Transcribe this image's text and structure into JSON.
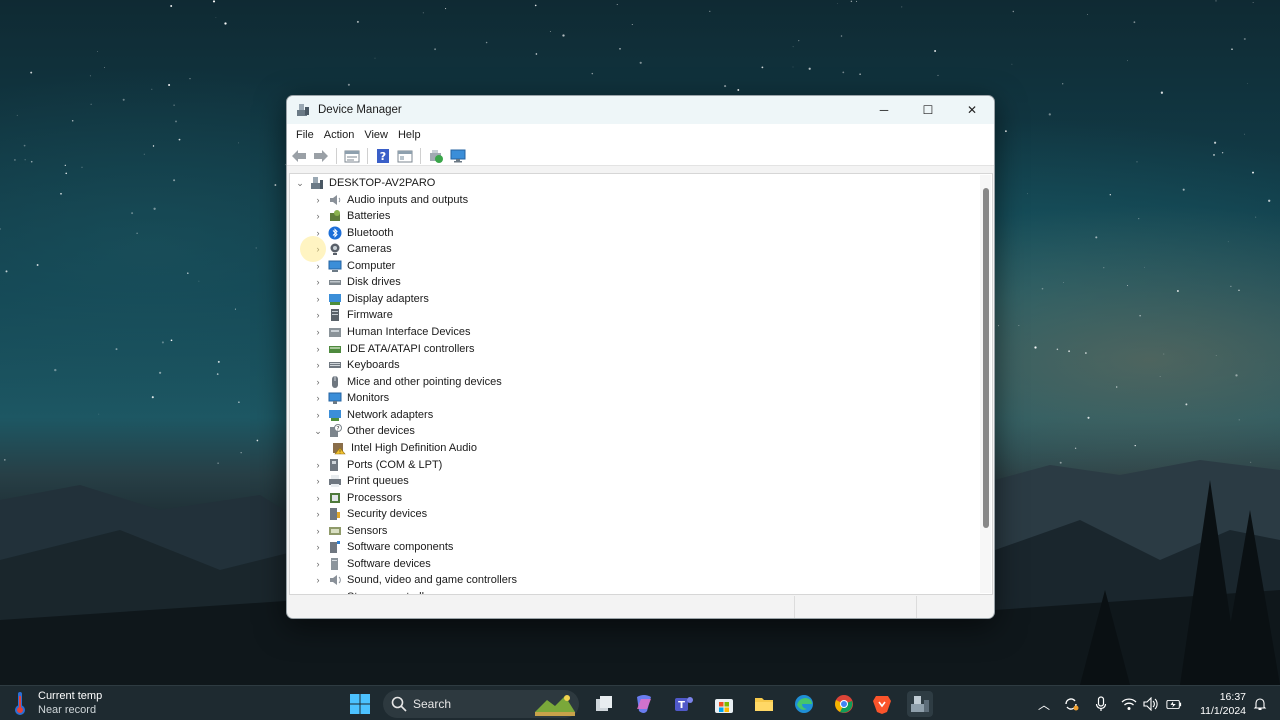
{
  "window": {
    "title": "Device Manager",
    "minimize_label": "─",
    "maximize_label": "☐",
    "close_label": "✕"
  },
  "menu": [
    "File",
    "Action",
    "View",
    "Help"
  ],
  "tree": {
    "root": "DESKTOP-AV2PARO",
    "items": [
      {
        "label": "Audio inputs and outputs",
        "icon": "speaker-icon",
        "expanded": false
      },
      {
        "label": "Batteries",
        "icon": "battery-icon",
        "expanded": false
      },
      {
        "label": "Bluetooth",
        "icon": "bluetooth-icon",
        "expanded": false
      },
      {
        "label": "Cameras",
        "icon": "camera-icon",
        "expanded": false
      },
      {
        "label": "Computer",
        "icon": "computer-icon",
        "expanded": false
      },
      {
        "label": "Disk drives",
        "icon": "disk-icon",
        "expanded": false
      },
      {
        "label": "Display adapters",
        "icon": "display-adapter-icon",
        "expanded": false
      },
      {
        "label": "Firmware",
        "icon": "firmware-icon",
        "expanded": false
      },
      {
        "label": "Human Interface Devices",
        "icon": "hid-icon",
        "expanded": false
      },
      {
        "label": "IDE ATA/ATAPI controllers",
        "icon": "ide-icon",
        "expanded": false
      },
      {
        "label": "Keyboards",
        "icon": "keyboard-icon",
        "expanded": false
      },
      {
        "label": "Mice and other pointing devices",
        "icon": "mouse-icon",
        "expanded": false
      },
      {
        "label": "Monitors",
        "icon": "monitor-icon",
        "expanded": false
      },
      {
        "label": "Network adapters",
        "icon": "network-icon",
        "expanded": false
      },
      {
        "label": "Other devices",
        "icon": "other-devices-icon",
        "expanded": true
      },
      {
        "label": "Intel High Definition Audio",
        "icon": "warning-device-icon",
        "child": true
      },
      {
        "label": "Ports (COM & LPT)",
        "icon": "port-icon",
        "expanded": false
      },
      {
        "label": "Print queues",
        "icon": "printer-icon",
        "expanded": false
      },
      {
        "label": "Processors",
        "icon": "processor-icon",
        "expanded": false
      },
      {
        "label": "Security devices",
        "icon": "security-icon",
        "expanded": false
      },
      {
        "label": "Sensors",
        "icon": "sensor-icon",
        "expanded": false
      },
      {
        "label": "Software components",
        "icon": "software-component-icon",
        "expanded": false
      },
      {
        "label": "Software devices",
        "icon": "software-device-icon",
        "expanded": false
      },
      {
        "label": "Sound, video and game controllers",
        "icon": "sound-icon",
        "expanded": false
      },
      {
        "label": "Storage controllers",
        "icon": "storage-icon",
        "expanded": false
      }
    ]
  },
  "taskbar": {
    "weather_title": "Current temp",
    "weather_subtitle": "Near record",
    "search_placeholder": "Search",
    "time": "16:37",
    "date": "11/1/2024"
  }
}
